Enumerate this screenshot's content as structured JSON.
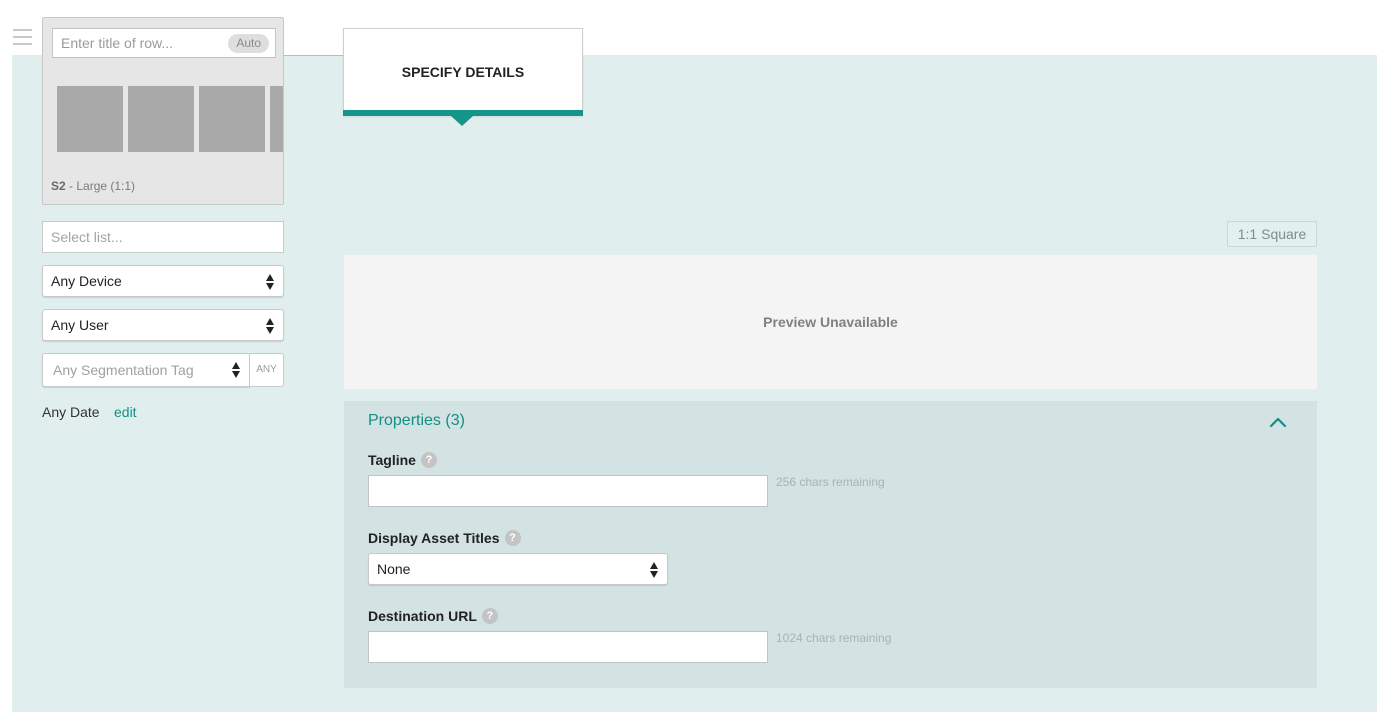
{
  "row_card": {
    "title_placeholder": "Enter title of row...",
    "auto_label": "Auto",
    "size_code": "S2",
    "size_text": " - Large (1:1)"
  },
  "filters": {
    "list_placeholder": "Select list...",
    "device": "Any Device",
    "user": "Any User",
    "segmentation": "Any Segmentation Tag",
    "any_button": "ANY",
    "date_label": "Any Date",
    "edit_link": "edit"
  },
  "tab": {
    "label": "SPECIFY DETAILS"
  },
  "aspect_badge": "1:1 Square",
  "preview": {
    "text": "Preview Unavailable"
  },
  "properties": {
    "title": "Properties (3)",
    "help_glyph": "?",
    "tagline": {
      "label": "Tagline",
      "remaining": "256 chars remaining"
    },
    "display_asset_titles": {
      "label": "Display Asset Titles",
      "value": "None"
    },
    "destination_url": {
      "label": "Destination URL",
      "remaining": "1024 chars remaining"
    }
  },
  "colors": {
    "accent": "#15948a",
    "panel_bg": "#e0eeee",
    "properties_bg": "#d3e2e2",
    "thumb": "#a9a9a9"
  }
}
